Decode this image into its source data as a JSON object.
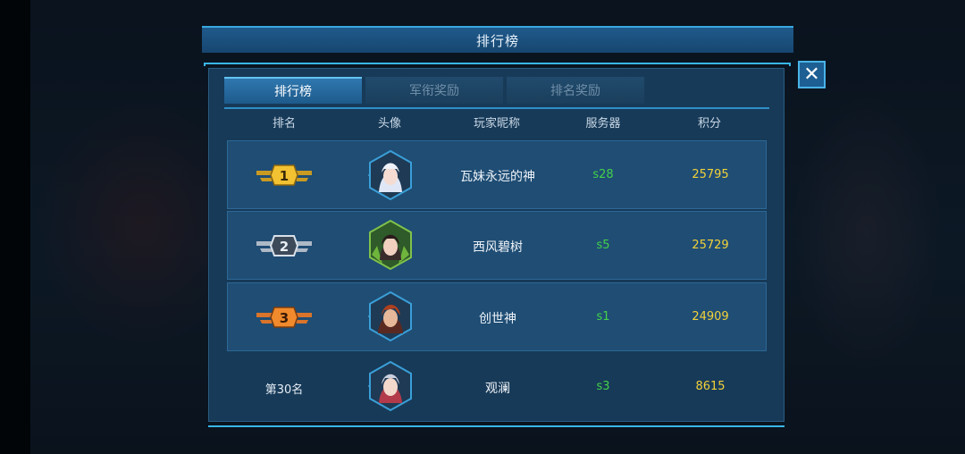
{
  "window": {
    "title": "排行榜",
    "close_symbol": "✕"
  },
  "tabs": [
    {
      "label": "排行榜",
      "active": true
    },
    {
      "label": "军衔奖励",
      "active": false
    },
    {
      "label": "排名奖励",
      "active": false
    }
  ],
  "columns": [
    "排名",
    "头像",
    "玩家昵称",
    "服务器",
    "积分"
  ],
  "rows": [
    {
      "rank": "1",
      "avatar": "white-haired-heroine-avatar",
      "name": "瓦妹永远的神",
      "server": "s28",
      "score": "25795"
    },
    {
      "rank": "2",
      "avatar": "dark-haired-heroine-avatar",
      "name": "西风碧树",
      "server": "s5",
      "score": "25729"
    },
    {
      "rank": "3",
      "avatar": "red-haired-hero-avatar",
      "name": "创世神",
      "server": "s1",
      "score": "24909"
    }
  ],
  "self": {
    "rank_label": "第30名",
    "avatar": "silver-haired-heroine-avatar",
    "name": "观澜",
    "server": "s3",
    "score": "8615"
  },
  "colors": {
    "gold": "#f2c232",
    "silver": "#d9e1ea",
    "bronze": "#f08a2c",
    "server_green": "#44d14a",
    "score_yellow": "#f2d23a",
    "accent_cyan": "#38b6e8"
  }
}
